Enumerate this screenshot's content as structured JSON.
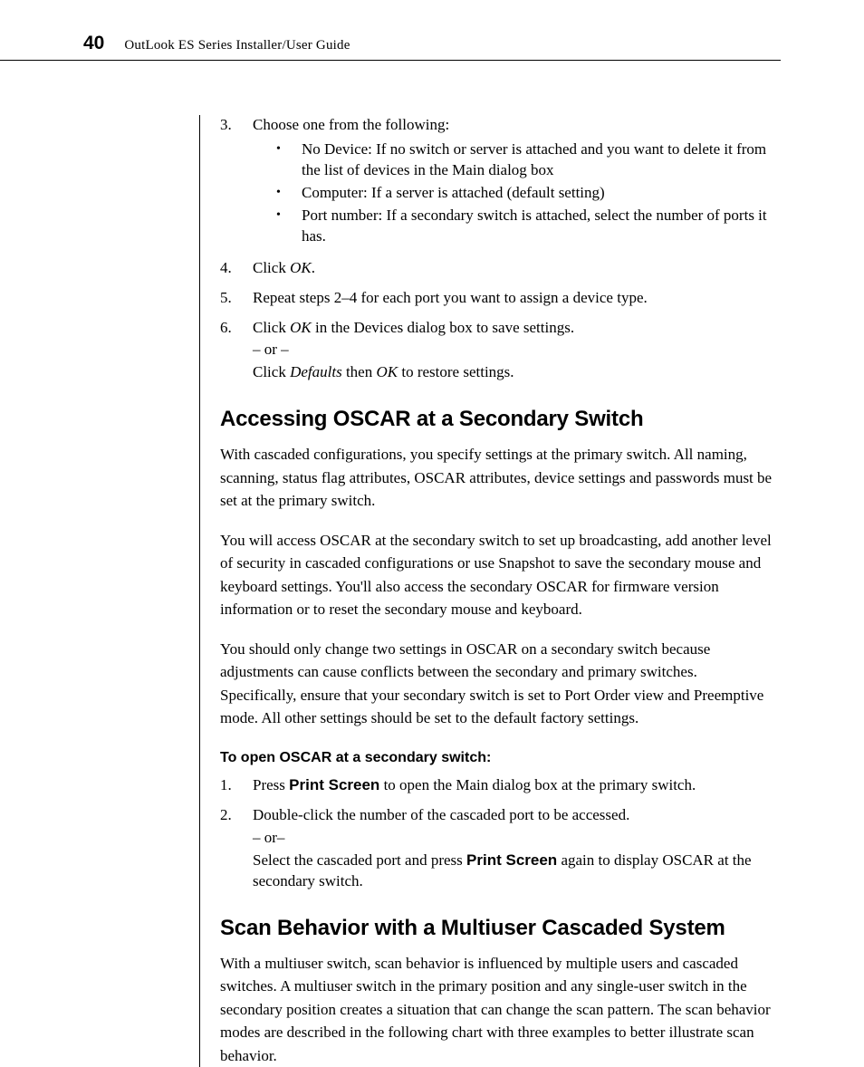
{
  "header": {
    "page_number": "40",
    "title": "OutLook ES Series Installer/User Guide"
  },
  "steps_top": {
    "s3_num": "3.",
    "s3_text": "Choose one from the following:",
    "s3_bullets": {
      "b1": "No Device: If no switch or server is attached and you want to delete it from the list of devices in the Main dialog box",
      "b2": "Computer: If a server is attached (default setting)",
      "b3": "Port number: If a secondary switch is attached, select the number of ports it has."
    },
    "s4_num": "4.",
    "s4_pre": "Click ",
    "s4_ok": "OK",
    "s4_post": ".",
    "s5_num": "5.",
    "s5_text": "Repeat steps 2–4 for each port you want to assign a device type.",
    "s6_num": "6.",
    "s6_pre": "Click ",
    "s6_ok": "OK",
    "s6_post": " in the Devices dialog box to save settings.",
    "s6_or": " – or –",
    "s6_sub_pre": " Click ",
    "s6_defaults": "Defaults",
    "s6_sub_mid": " then ",
    "s6_sub_ok": "OK",
    "s6_sub_post": " to restore settings."
  },
  "section1": {
    "heading": "Accessing OSCAR at a Secondary Switch",
    "p1": "With cascaded configurations, you specify settings at the primary switch. All naming, scanning, status flag attributes, OSCAR attributes, device settings and passwords must be set at the primary switch.",
    "p2": "You will access OSCAR at the secondary switch to set up broadcasting, add another level of security in cascaded configurations or use Snapshot to save the secondary mouse and keyboard settings. You'll also access the secondary OSCAR for firmware version information or to reset the secondary mouse and keyboard.",
    "p3": "You should only change two settings in OSCAR on a secondary switch because adjustments can cause conflicts between the secondary and primary switches. Specifically, ensure that your secondary switch is set to Port Order view and Preemptive mode. All other settings should be set to the default factory settings.",
    "subheading": "To open OSCAR at a secondary switch:",
    "step1_num": "1.",
    "step1_pre": "Press ",
    "step1_ps": "Print Screen",
    "step1_post": " to open the Main dialog box at the primary switch.",
    "step2_num": "2.",
    "step2_text": "Double-click the number of the cascaded port to be accessed.",
    "step2_or": "– or–",
    "step2_sub_pre": "Select the cascaded port and press ",
    "step2_sub_ps": "Print Screen",
    "step2_sub_post": " again to display OSCAR at the secondary switch."
  },
  "section2": {
    "heading": "Scan Behavior with a Multiuser Cascaded System",
    "p1": "With a multiuser switch, scan behavior is influenced by multiple users and cascaded switches. A multiuser switch in the primary position and any single-user switch in the secondary position creates a situation that can change the scan pattern. The scan behavior modes are described in the following chart with three examples to better illustrate scan behavior."
  }
}
